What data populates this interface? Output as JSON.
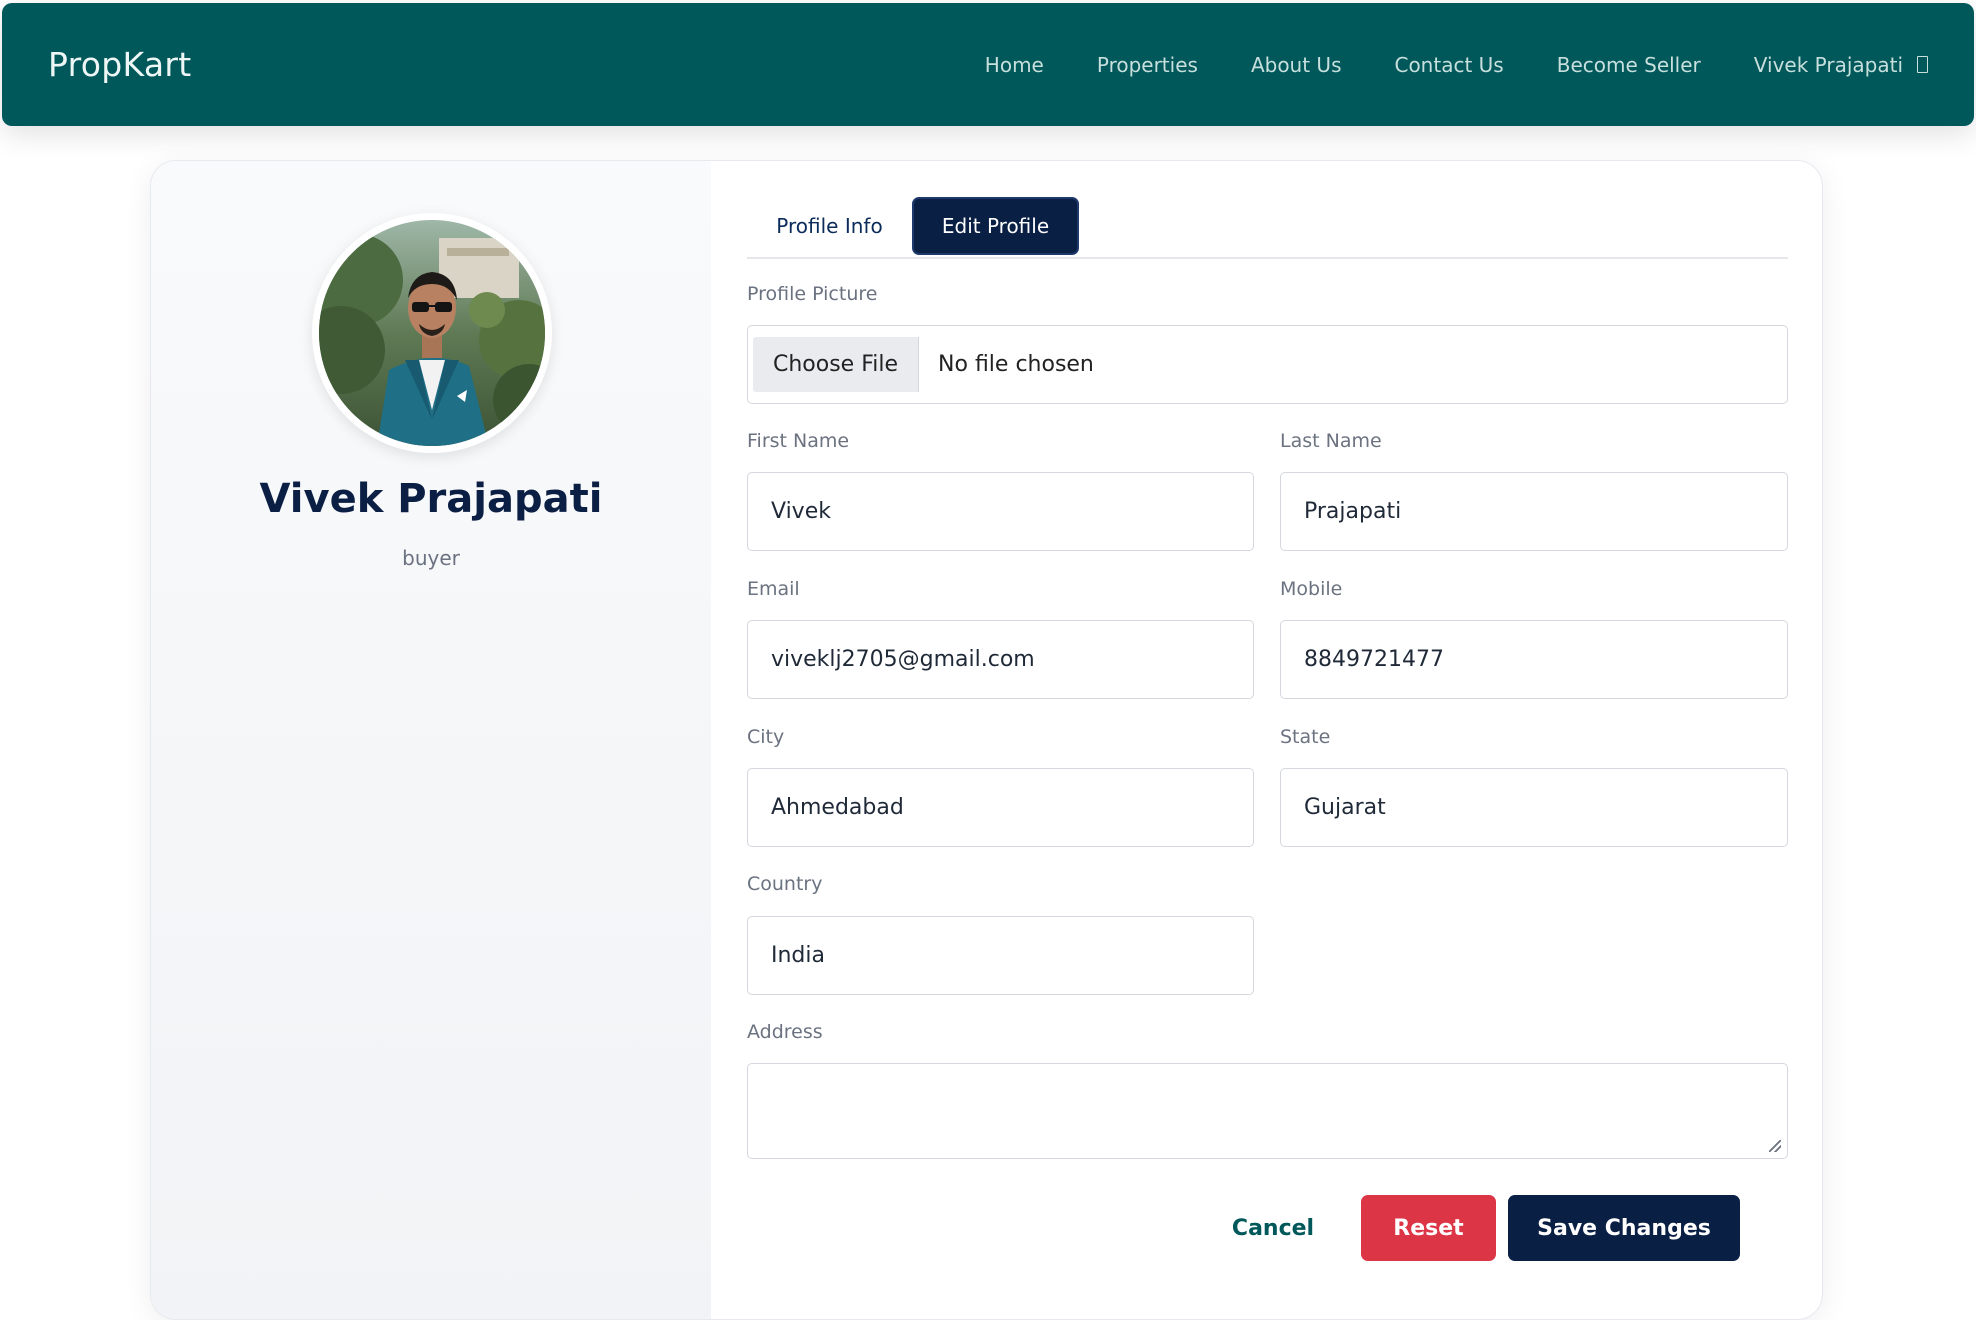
{
  "nav": {
    "brand": "PropKart",
    "links": [
      "Home",
      "Properties",
      "About Us",
      "Contact Us",
      "Become Seller"
    ],
    "user_name": "Vivek Prajapati"
  },
  "profile": {
    "name": "Vivek Prajapati",
    "role": "buyer"
  },
  "tabs": {
    "info": "Profile Info",
    "edit": "Edit Profile",
    "active": "Edit Profile"
  },
  "form": {
    "picture_label": "Profile Picture",
    "choose_file": "Choose File",
    "file_status": "No file chosen",
    "first_name_label": "First Name",
    "first_name": "Vivek",
    "last_name_label": "Last Name",
    "last_name": "Prajapati",
    "email_label": "Email",
    "email": "viveklj2705@gmail.com",
    "mobile_label": "Mobile",
    "mobile": "8849721477",
    "city_label": "City",
    "city": "Ahmedabad",
    "state_label": "State",
    "state": "Gujarat",
    "country_label": "Country",
    "country": "India",
    "address_label": "Address",
    "address": ""
  },
  "actions": {
    "cancel": "Cancel",
    "reset": "Reset",
    "save": "Save Changes"
  },
  "colors": {
    "nav_bg": "#01585a",
    "primary_navy": "#0a1f44",
    "reset_red": "#dc3545"
  }
}
